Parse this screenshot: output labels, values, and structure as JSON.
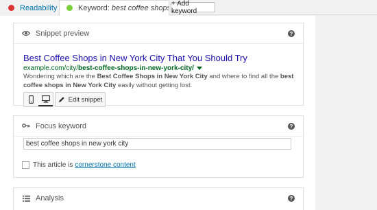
{
  "tabs": {
    "readability": "Readability",
    "keyword_prefix": "Keyword:",
    "keyword_value": "best coffee shops i...",
    "add_keyword": "+ Add keyword"
  },
  "snippet": {
    "header": "Snippet preview",
    "title": "Best Coffee Shops in New York City That You Should Try",
    "url_base": "example.com/city/",
    "url_slug": "best-coffee-shops-in-new-york-city/",
    "desc_1": "Wondering which are the ",
    "desc_b1": "Best Coffee Shops in New York City",
    "desc_2": " and where to find all the ",
    "desc_b2": "best coffee shops in New York City",
    "desc_3": " easily without getting lost.",
    "edit_label": "Edit snippet"
  },
  "focus": {
    "header": "Focus keyword",
    "value": "best coffee shops in new york city",
    "cornerstone_text": "This article is",
    "cornerstone_link": "cornerstone content"
  },
  "analysis": {
    "header": "Analysis"
  },
  "help_glyph": "?"
}
